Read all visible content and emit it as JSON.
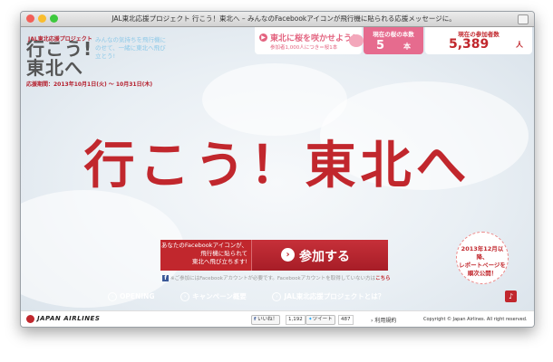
{
  "window": {
    "title": "JAL東北応援プロジェクト 行こう！東北へ – みんなのFacebookアイコンが飛行機に貼られる応援メッセージに。"
  },
  "header": {
    "logo_sub": "JAL東北応援プロジェクト",
    "logo_line1": "行こう!",
    "logo_line2": "東北へ",
    "tagline": "みんなの気持ちを飛行機にのせて、一緒に東北へ飛び立とう!",
    "period": "応援期間：2013年10月1日(火) 〜 10月31日(木)"
  },
  "sakura": {
    "title": "東北に桜を咲かせよう！",
    "rule": "参加者1,000人につき＝桜1本"
  },
  "stats": {
    "cherry_label": "現在の桜の本数",
    "cherry_count": "5",
    "cherry_unit": "本",
    "participants_label": "現在の参加者数",
    "participants_count": "5,389",
    "participants_unit": "人"
  },
  "hero": {
    "headline": "行こう！東北へ"
  },
  "cta": {
    "description_line1": "あなたのFacebookアイコンが、",
    "description_line2": "飛行機に貼られて",
    "description_line3": "東北へ飛び立ちます!",
    "button_label": "参加する",
    "fb_note": "※ご参加にはFacebookアカウントが必要です。Facebookアカウントを取得していない方は",
    "fb_link": "こちら"
  },
  "badge": {
    "line1": "2013年12月以降、",
    "line2": "レポートページを",
    "line3": "順次公開！"
  },
  "nav": {
    "items": [
      {
        "label": "OPENING"
      },
      {
        "label": "キャンペーン概要"
      },
      {
        "label": "JAL東北応援プロジェクトとは？"
      }
    ]
  },
  "footer": {
    "airline_name": "JAPAN AIRLINES",
    "like_label": "いいね！",
    "like_count": "1,192",
    "tweet_label": "ツイート",
    "tweet_count": "487",
    "terms": "利用規約",
    "copyright": "Copyright © Japan Airlines. All right reserved."
  },
  "colors": {
    "brand_red": "#c1272d",
    "sakura_pink": "#e66b8e",
    "facebook_blue": "#3b5998"
  }
}
